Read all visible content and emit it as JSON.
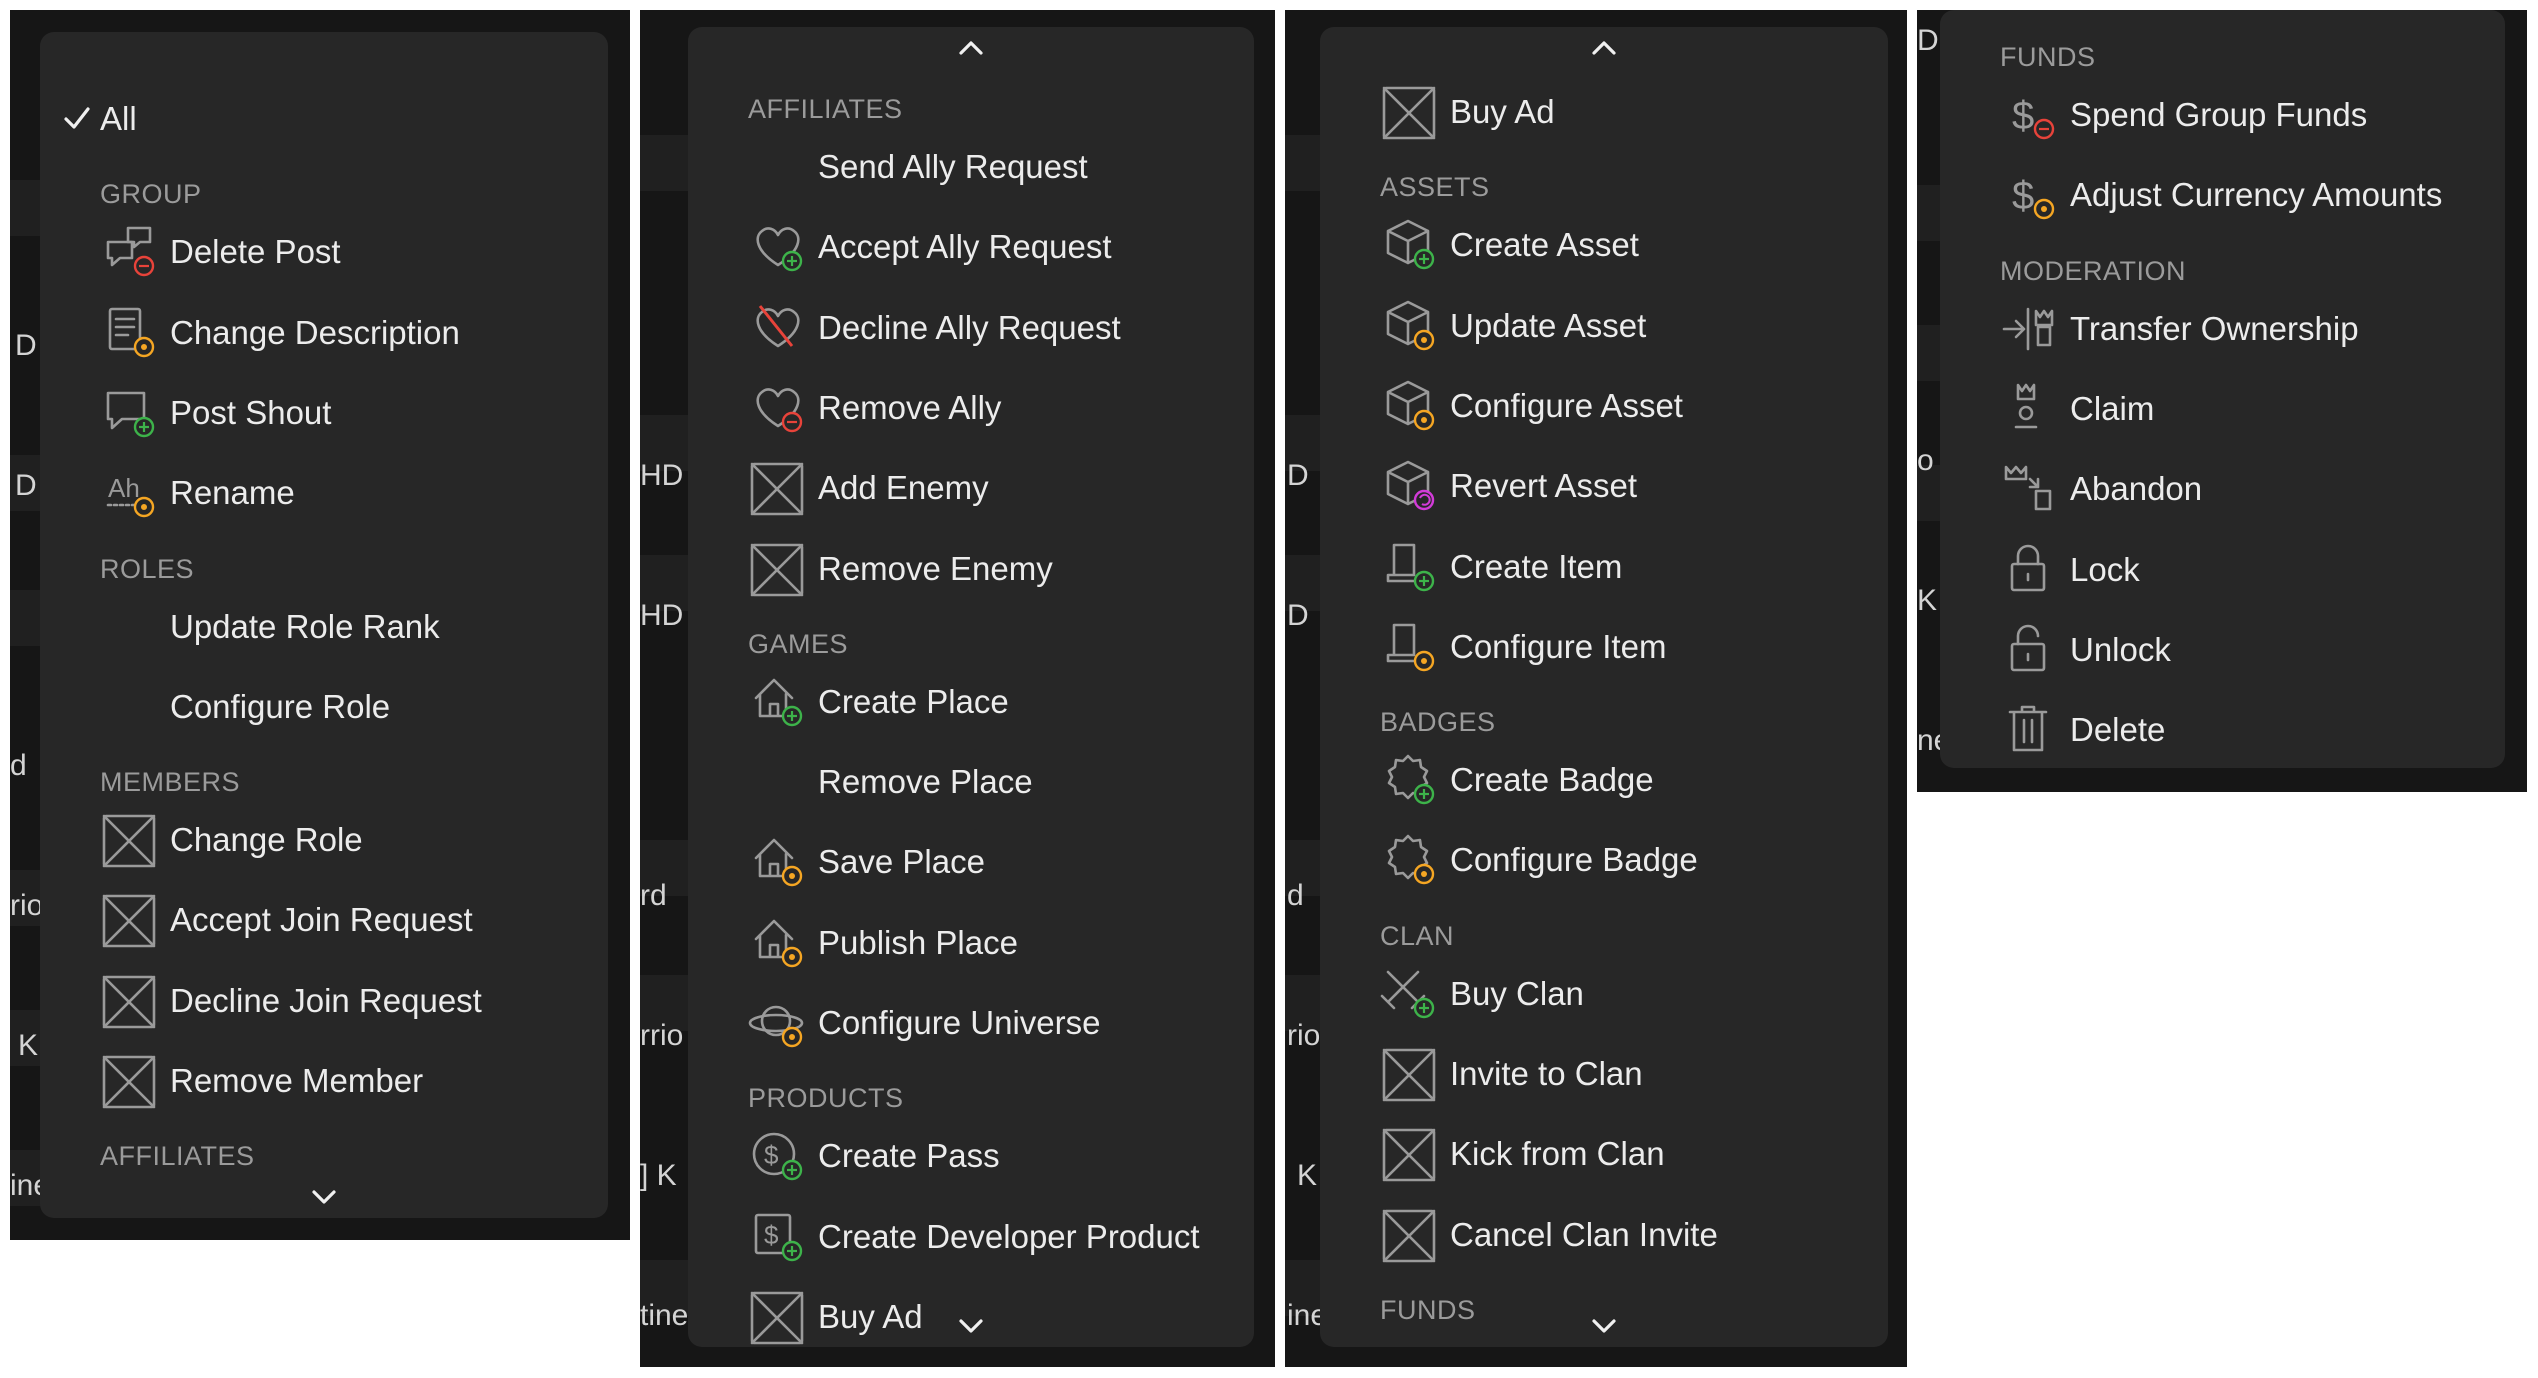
{
  "colors": {
    "menu_bg": "#272727",
    "panel_bg": "#161616",
    "text": "#ececec",
    "header": "#9b9b9b",
    "badge_add": "#3db34a",
    "badge_edit": "#f5a623",
    "badge_remove": "#e8433a",
    "badge_revert": "#d23bd8"
  },
  "panels": [
    {
      "edge_fragments": [
        "D",
        "D",
        "d",
        "rio",
        "K",
        "ine"
      ],
      "scroll_up": false,
      "scroll_down": true,
      "entries": [
        {
          "kind": "item",
          "label": "All",
          "icon": "checkmark-icon",
          "checked": true
        },
        {
          "kind": "header",
          "label": "GROUP"
        },
        {
          "kind": "item",
          "label": "Delete Post",
          "icon": "delete-post-icon",
          "badge": "remove"
        },
        {
          "kind": "item",
          "label": "Change Description",
          "icon": "description-icon",
          "badge": "edit"
        },
        {
          "kind": "item",
          "label": "Post Shout",
          "icon": "shout-icon",
          "badge": "add"
        },
        {
          "kind": "item",
          "label": "Rename",
          "icon": "rename-icon",
          "badge": "edit"
        },
        {
          "kind": "header",
          "label": "ROLES"
        },
        {
          "kind": "item",
          "label": "Update Role Rank",
          "icon": "none"
        },
        {
          "kind": "item",
          "label": "Configure Role",
          "icon": "none"
        },
        {
          "kind": "header",
          "label": "MEMBERS"
        },
        {
          "kind": "item",
          "label": "Change Role",
          "icon": "placeholder-box-icon"
        },
        {
          "kind": "item",
          "label": "Accept Join Request",
          "icon": "placeholder-box-icon"
        },
        {
          "kind": "item",
          "label": "Decline Join Request",
          "icon": "placeholder-box-icon"
        },
        {
          "kind": "item",
          "label": "Remove Member",
          "icon": "placeholder-box-icon"
        },
        {
          "kind": "header",
          "label": "AFFILIATES"
        }
      ]
    },
    {
      "edge_fragments": [
        "HD",
        "HD",
        "rd",
        "rrio",
        "] K",
        "tine"
      ],
      "scroll_up": true,
      "scroll_down": true,
      "entries": [
        {
          "kind": "header",
          "label": "AFFILIATES"
        },
        {
          "kind": "item",
          "label": "Send Ally Request",
          "icon": "none"
        },
        {
          "kind": "item",
          "label": "Accept Ally Request",
          "icon": "heart-icon",
          "badge": "add"
        },
        {
          "kind": "item",
          "label": "Decline Ally Request",
          "icon": "heart-broken-icon"
        },
        {
          "kind": "item",
          "label": "Remove Ally",
          "icon": "heart-icon",
          "badge": "remove"
        },
        {
          "kind": "item",
          "label": "Add Enemy",
          "icon": "placeholder-box-icon"
        },
        {
          "kind": "item",
          "label": "Remove Enemy",
          "icon": "placeholder-box-icon"
        },
        {
          "kind": "header",
          "label": "GAMES"
        },
        {
          "kind": "item",
          "label": "Create Place",
          "icon": "house-icon",
          "badge": "add"
        },
        {
          "kind": "item",
          "label": "Remove Place",
          "icon": "none"
        },
        {
          "kind": "item",
          "label": "Save Place",
          "icon": "house-icon",
          "badge": "edit"
        },
        {
          "kind": "item",
          "label": "Publish Place",
          "icon": "house-icon",
          "badge": "edit"
        },
        {
          "kind": "item",
          "label": "Configure Universe",
          "icon": "planet-icon",
          "badge": "edit"
        },
        {
          "kind": "header",
          "label": "PRODUCTS"
        },
        {
          "kind": "item",
          "label": "Create Pass",
          "icon": "pass-icon",
          "badge": "add"
        },
        {
          "kind": "item",
          "label": "Create Developer Product",
          "icon": "dev-product-icon",
          "badge": "add"
        },
        {
          "kind": "item",
          "label": "Buy Ad",
          "icon": "placeholder-box-icon"
        }
      ]
    },
    {
      "edge_fragments": [
        "D",
        "D",
        "d",
        "rio",
        "K",
        "ine"
      ],
      "scroll_up": true,
      "scroll_down": true,
      "entries": [
        {
          "kind": "item",
          "label": "Buy Ad",
          "icon": "placeholder-box-icon"
        },
        {
          "kind": "header",
          "label": "ASSETS"
        },
        {
          "kind": "item",
          "label": "Create Asset",
          "icon": "cube-icon",
          "badge": "add"
        },
        {
          "kind": "item",
          "label": "Update Asset",
          "icon": "cube-icon",
          "badge": "edit"
        },
        {
          "kind": "item",
          "label": "Configure Asset",
          "icon": "cube-icon",
          "badge": "edit"
        },
        {
          "kind": "item",
          "label": "Revert Asset",
          "icon": "cube-icon",
          "badge": "revert"
        },
        {
          "kind": "item",
          "label": "Create Item",
          "icon": "item-icon",
          "badge": "add"
        },
        {
          "kind": "item",
          "label": "Configure Item",
          "icon": "item-icon",
          "badge": "edit"
        },
        {
          "kind": "header",
          "label": "BADGES"
        },
        {
          "kind": "item",
          "label": "Create Badge",
          "icon": "badge-icon",
          "badge": "add"
        },
        {
          "kind": "item",
          "label": "Configure Badge",
          "icon": "badge-icon",
          "badge": "edit"
        },
        {
          "kind": "header",
          "label": "CLAN"
        },
        {
          "kind": "item",
          "label": "Buy Clan",
          "icon": "swords-icon",
          "badge": "add"
        },
        {
          "kind": "item",
          "label": "Invite to Clan",
          "icon": "placeholder-box-icon"
        },
        {
          "kind": "item",
          "label": "Kick from Clan",
          "icon": "placeholder-box-icon"
        },
        {
          "kind": "item",
          "label": "Cancel Clan Invite",
          "icon": "placeholder-box-icon"
        },
        {
          "kind": "header",
          "label": "FUNDS"
        }
      ]
    },
    {
      "edge_fragments": [
        "D",
        "o",
        "K",
        "ne"
      ],
      "scroll_up": false,
      "scroll_down": false,
      "entries": [
        {
          "kind": "header",
          "label": "FUNDS"
        },
        {
          "kind": "item",
          "label": "Spend Group Funds",
          "icon": "dollar-icon",
          "badge": "remove"
        },
        {
          "kind": "item",
          "label": "Adjust Currency Amounts",
          "icon": "dollar-icon",
          "badge": "edit"
        },
        {
          "kind": "header",
          "label": "MODERATION"
        },
        {
          "kind": "item",
          "label": "Transfer Ownership",
          "icon": "transfer-ownership-icon"
        },
        {
          "kind": "item",
          "label": "Claim",
          "icon": "claim-icon"
        },
        {
          "kind": "item",
          "label": "Abandon",
          "icon": "abandon-icon"
        },
        {
          "kind": "item",
          "label": "Lock",
          "icon": "lock-icon"
        },
        {
          "kind": "item",
          "label": "Unlock",
          "icon": "unlock-icon"
        },
        {
          "kind": "item",
          "label": "Delete",
          "icon": "trash-icon"
        }
      ]
    }
  ]
}
